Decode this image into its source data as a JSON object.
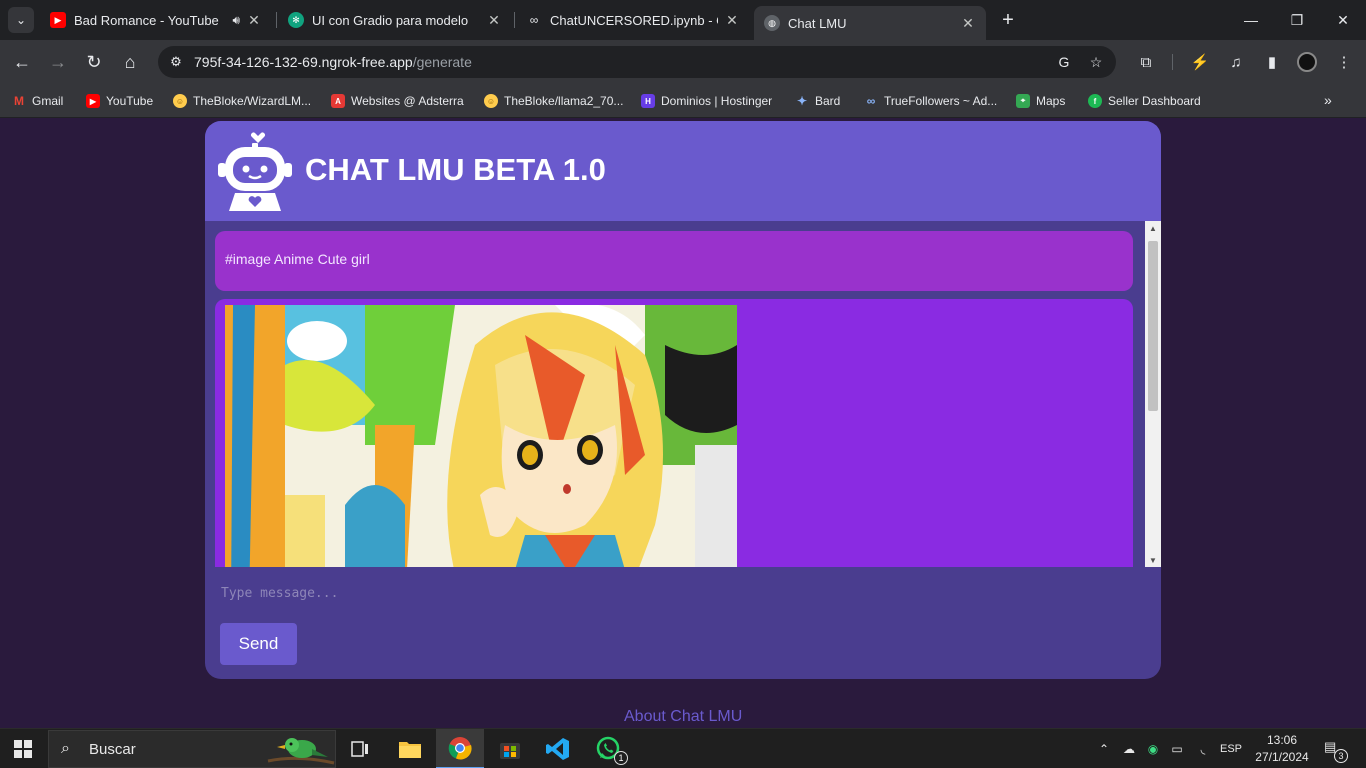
{
  "browser": {
    "tabs": [
      {
        "title": "Bad Romance - YouTube",
        "favicon": "youtube-icon",
        "color": "#ff0000",
        "audio": true
      },
      {
        "title": "UI con Gradio para modelo",
        "favicon": "openai-icon",
        "color": "#10a37f"
      },
      {
        "title": "ChatUNCERSORED.ipynb - Cola",
        "favicon": "colab-icon",
        "color": "#f9ab00"
      },
      {
        "title": "Chat LMU",
        "favicon": "globe-icon",
        "color": "#9aa0a6",
        "active": true
      }
    ],
    "url_host": "795f-34-126-132-69.ngrok-free.app",
    "url_path": "/generate",
    "bookmarks": [
      {
        "label": "Gmail",
        "icon": "gmail-icon",
        "color": "#ea4335"
      },
      {
        "label": "YouTube",
        "icon": "youtube-icon",
        "color": "#ff0000"
      },
      {
        "label": "TheBloke/WizardLM...",
        "icon": "huggingface-icon",
        "color": "#ffcc4d"
      },
      {
        "label": "Websites @ Adsterra",
        "icon": "adsterra-icon",
        "color": "#e53935"
      },
      {
        "label": "TheBloke/llama2_70...",
        "icon": "huggingface-icon",
        "color": "#ffcc4d"
      },
      {
        "label": "Dominios | Hostinger",
        "icon": "hostinger-icon",
        "color": "#673de6"
      },
      {
        "label": "Bard",
        "icon": "bard-icon",
        "color": "#8ab4f8"
      },
      {
        "label": "TrueFollowers ~ Ad...",
        "icon": "truefollowers-icon",
        "color": "#4c6ef5"
      },
      {
        "label": "Maps",
        "icon": "maps-icon",
        "color": "#34a853"
      },
      {
        "label": "Seller Dashboard",
        "icon": "seller-icon",
        "color": "#1db954"
      }
    ]
  },
  "app": {
    "title": "CHAT LMU BETA 1.0",
    "user_message": "#image Anime Cute girl",
    "input_placeholder": "Type message...",
    "send_label": "Send",
    "about_label": "About Chat LMU",
    "colors": {
      "header": "#6a5acd",
      "card": "#4a3d8f",
      "user_bubble": "#9932cc",
      "bot_bubble": "#8a2be2",
      "page_bg": "#2a1a3d"
    }
  },
  "taskbar": {
    "search_label": "Buscar",
    "language": "ESP",
    "time": "13:06",
    "date": "27/1/2024",
    "whatsapp_badge": "1",
    "notification_count": "3"
  }
}
